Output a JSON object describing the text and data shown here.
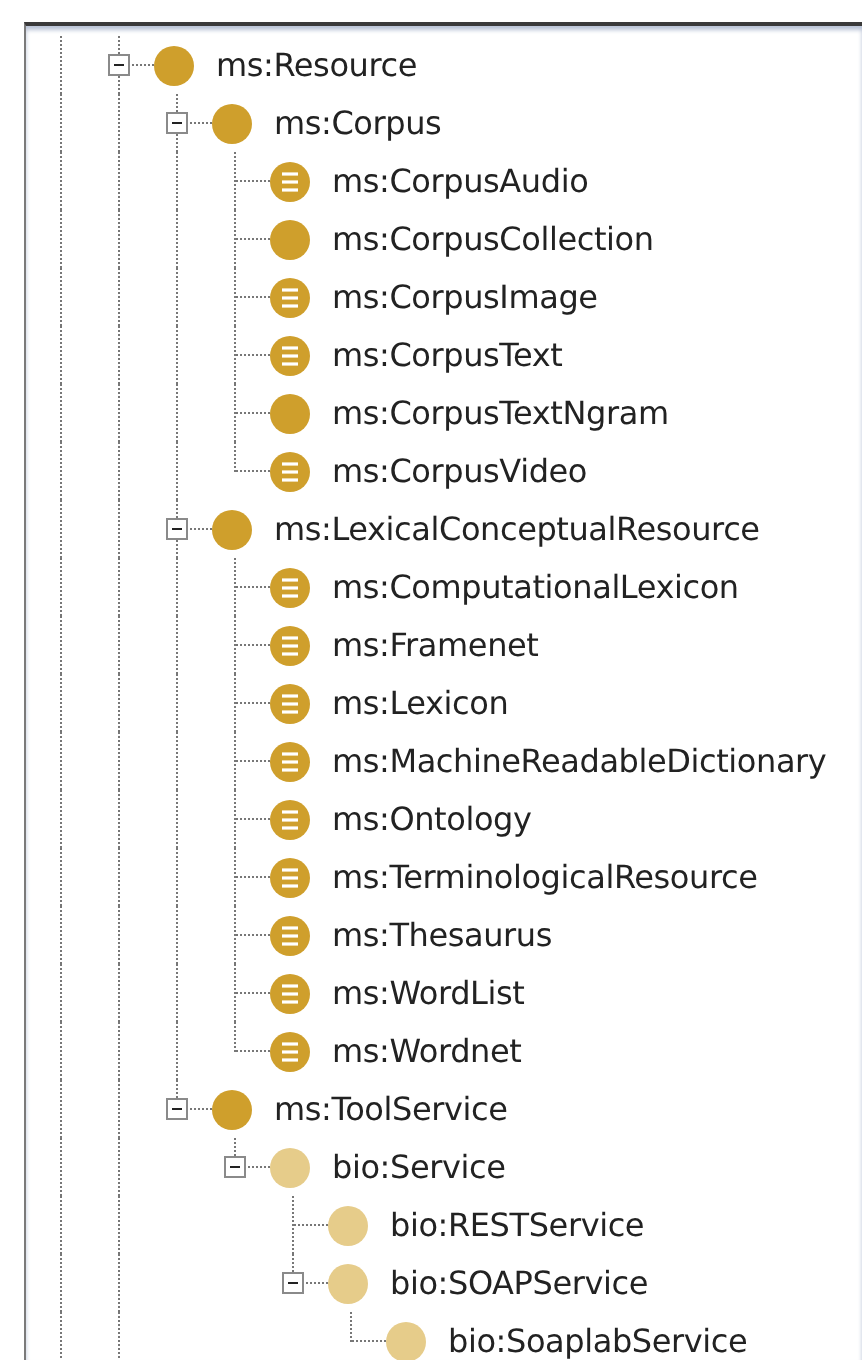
{
  "class_tree": [
    {
      "label": "ms:Resource",
      "kind": "primitive",
      "imported": false,
      "expanded": true,
      "children": [
        {
          "label": "ms:Corpus",
          "kind": "primitive",
          "imported": false,
          "expanded": true,
          "children": [
            {
              "label": "ms:CorpusAudio",
              "kind": "defined",
              "imported": false
            },
            {
              "label": "ms:CorpusCollection",
              "kind": "primitive",
              "imported": false
            },
            {
              "label": "ms:CorpusImage",
              "kind": "defined",
              "imported": false
            },
            {
              "label": "ms:CorpusText",
              "kind": "defined",
              "imported": false
            },
            {
              "label": "ms:CorpusTextNgram",
              "kind": "primitive",
              "imported": false
            },
            {
              "label": "ms:CorpusVideo",
              "kind": "defined",
              "imported": false
            }
          ]
        },
        {
          "label": "ms:LexicalConceptualResource",
          "kind": "primitive",
          "imported": false,
          "expanded": true,
          "children": [
            {
              "label": "ms:ComputationalLexicon",
              "kind": "defined",
              "imported": false
            },
            {
              "label": "ms:Framenet",
              "kind": "defined",
              "imported": false
            },
            {
              "label": "ms:Lexicon",
              "kind": "defined",
              "imported": false
            },
            {
              "label": "ms:MachineReadableDictionary",
              "kind": "defined",
              "imported": false
            },
            {
              "label": "ms:Ontology",
              "kind": "defined",
              "imported": false
            },
            {
              "label": "ms:TerminologicalResource",
              "kind": "defined",
              "imported": false
            },
            {
              "label": "ms:Thesaurus",
              "kind": "defined",
              "imported": false
            },
            {
              "label": "ms:WordList",
              "kind": "defined",
              "imported": false
            },
            {
              "label": "ms:Wordnet",
              "kind": "defined",
              "imported": false
            }
          ]
        },
        {
          "label": "ms:ToolService",
          "kind": "primitive",
          "imported": false,
          "expanded": true,
          "children": [
            {
              "label": "bio:Service",
              "kind": "primitive",
              "imported": true,
              "expanded": true,
              "children": [
                {
                  "label": "bio:RESTService",
                  "kind": "primitive",
                  "imported": true
                },
                {
                  "label": "bio:SOAPService",
                  "kind": "primitive",
                  "imported": true,
                  "expanded": true,
                  "children": [
                    {
                      "label": "bio:SoaplabService",
                      "kind": "primitive",
                      "imported": true
                    }
                  ]
                }
              ]
            }
          ]
        }
      ]
    }
  ]
}
